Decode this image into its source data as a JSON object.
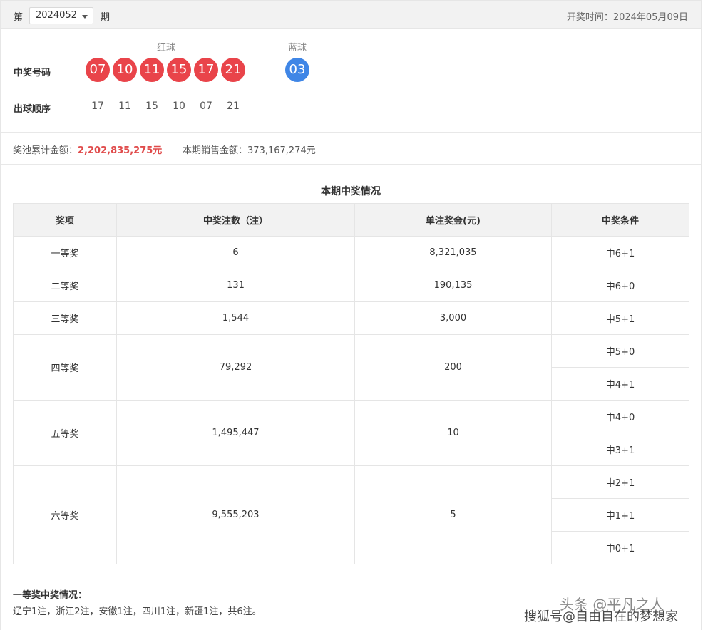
{
  "header": {
    "prefix": "第",
    "period": "2024052",
    "suffix": "期",
    "draw_date": "开奖时间：2024年05月09日"
  },
  "draw": {
    "red_header": "红球",
    "blue_header": "蓝球",
    "numbers_label": "中奖号码",
    "red": [
      "07",
      "10",
      "11",
      "15",
      "17",
      "21"
    ],
    "blue": "03",
    "order_label": "出球顺序",
    "order": [
      "17",
      "11",
      "15",
      "10",
      "07",
      "21"
    ]
  },
  "pool": {
    "pool_label": "奖池累计金额：",
    "pool_amount": "2,202,835,275元",
    "sales_label": "本期销售金额：",
    "sales_amount": "373,167,274元"
  },
  "table": {
    "title": "本期中奖情况",
    "headers": [
      "奖项",
      "中奖注数（注）",
      "单注奖金(元)",
      "中奖条件"
    ],
    "rows": [
      {
        "level": "一等奖",
        "count": "6",
        "prize": "8,321,035",
        "conditions": [
          "中6+1"
        ]
      },
      {
        "level": "二等奖",
        "count": "131",
        "prize": "190,135",
        "conditions": [
          "中6+0"
        ]
      },
      {
        "level": "三等奖",
        "count": "1,544",
        "prize": "3,000",
        "conditions": [
          "中5+1"
        ]
      },
      {
        "level": "四等奖",
        "count": "79,292",
        "prize": "200",
        "conditions": [
          "中5+0",
          "中4+1"
        ]
      },
      {
        "level": "五等奖",
        "count": "1,495,447",
        "prize": "10",
        "conditions": [
          "中4+0",
          "中3+1"
        ]
      },
      {
        "level": "六等奖",
        "count": "9,555,203",
        "prize": "5",
        "conditions": [
          "中2+1",
          "中1+1",
          "中0+1"
        ]
      }
    ]
  },
  "first_prize": {
    "title": "一等奖中奖情况：",
    "detail": "辽宁1注，浙江2注，安徽1注，四川1注，新疆1注，共6注。"
  },
  "watermark": {
    "line1": "头条 @平凡之人",
    "line2": "搜狐号@自由自在的梦想家"
  }
}
